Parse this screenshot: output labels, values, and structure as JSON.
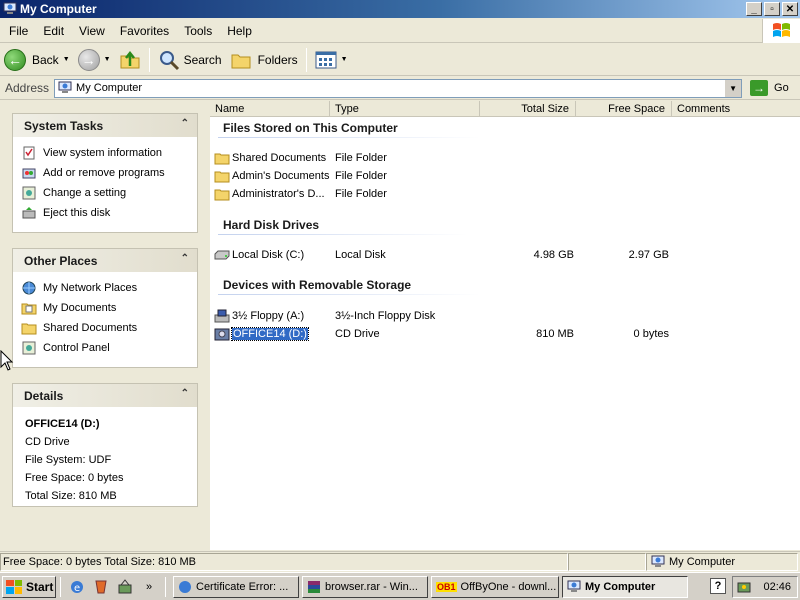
{
  "window": {
    "title": "My Computer",
    "controls": [
      "_",
      "▫",
      "✕"
    ]
  },
  "menu": [
    "File",
    "Edit",
    "View",
    "Favorites",
    "Tools",
    "Help"
  ],
  "toolbar": {
    "back_label": "Back",
    "search_label": "Search",
    "folders_label": "Folders"
  },
  "address": {
    "label": "Address",
    "value": "My Computer",
    "go_label": "Go"
  },
  "system_tasks": {
    "title": "System Tasks",
    "items": [
      "View system information",
      "Add or remove programs",
      "Change a setting",
      "Eject this disk"
    ]
  },
  "other_places": {
    "title": "Other Places",
    "items": [
      "My Network Places",
      "My Documents",
      "Shared Documents",
      "Control Panel"
    ]
  },
  "details": {
    "title": "Details",
    "name": "OFFICE14 (D:)",
    "type": "CD Drive",
    "file_system": "File System: UDF",
    "free_space": "Free Space: 0 bytes",
    "total_size": "Total Size: 810 MB"
  },
  "columns": [
    "Name",
    "Type",
    "Total Size",
    "Free Space",
    "Comments"
  ],
  "groups": {
    "files": {
      "title": "Files Stored on This Computer",
      "rows": [
        {
          "name": "Shared Documents",
          "type": "File Folder",
          "total": "",
          "free": ""
        },
        {
          "name": "Admin's Documents",
          "type": "File Folder",
          "total": "",
          "free": ""
        },
        {
          "name": "Administrator's D...",
          "type": "File Folder",
          "total": "",
          "free": ""
        }
      ]
    },
    "hdd": {
      "title": "Hard Disk Drives",
      "rows": [
        {
          "name": "Local Disk (C:)",
          "type": "Local Disk",
          "total": "4.98 GB",
          "free": "2.97 GB"
        }
      ]
    },
    "removable": {
      "title": "Devices with Removable Storage",
      "rows": [
        {
          "name": "3½ Floppy (A:)",
          "type": "3½-Inch Floppy Disk",
          "total": "",
          "free": ""
        },
        {
          "name": "OFFICE14 (D:)",
          "type": "CD Drive",
          "total": "810 MB",
          "free": "0 bytes"
        }
      ]
    }
  },
  "statusbar": {
    "left": "Free Space: 0 bytes Total Size: 810 MB",
    "right": "My Computer"
  },
  "taskbar": {
    "start": "Start",
    "more": "»",
    "tasks": [
      {
        "label": "Certificate Error: ...",
        "active": false
      },
      {
        "label": "browser.rar - Win...",
        "active": false
      },
      {
        "label": "OffByOne - downl...",
        "active": false
      },
      {
        "label": "My Computer",
        "active": true
      }
    ],
    "ob1_badge": "OB1",
    "help_glyph": "?",
    "clock": "02:46"
  },
  "colors": {
    "titlebar_start": "#0a246a",
    "selection": "#316ac5",
    "folder": "#f4d46a"
  }
}
